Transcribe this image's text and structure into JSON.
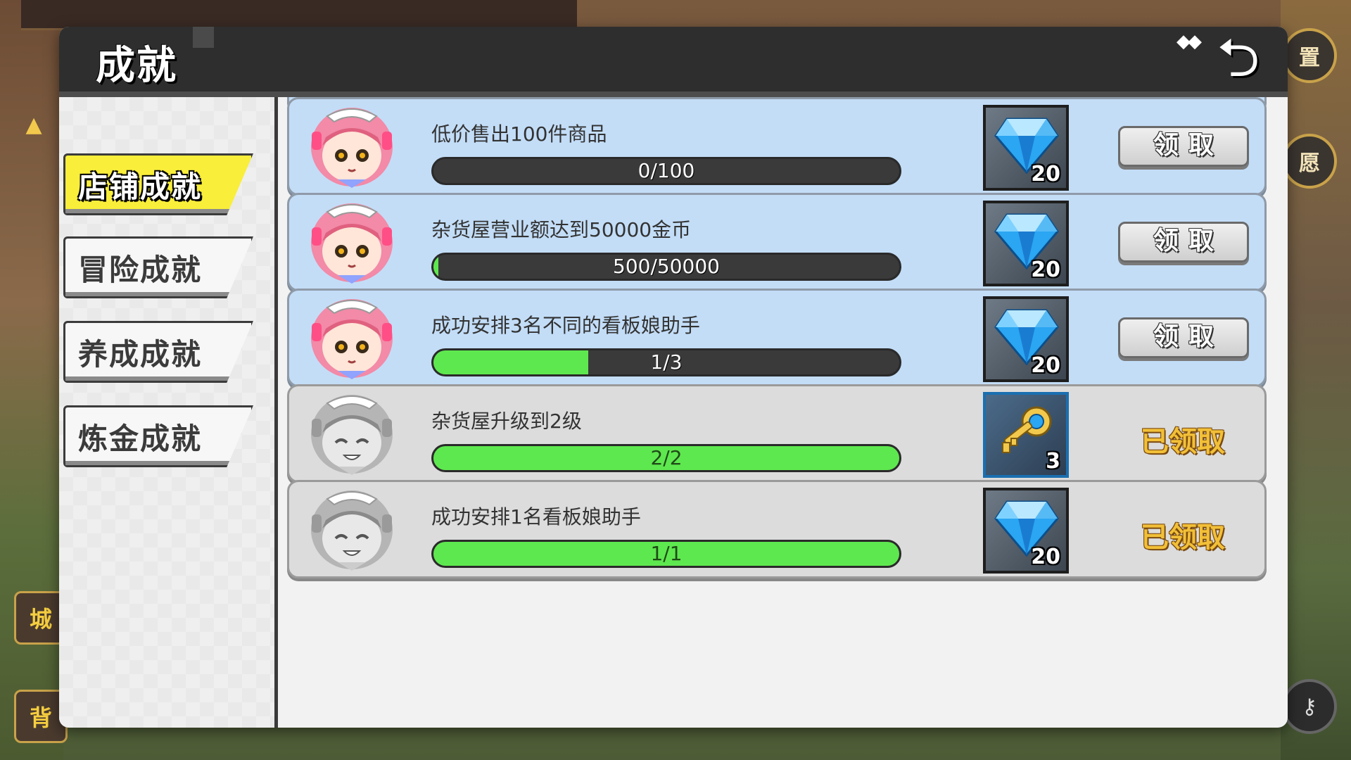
{
  "header": {
    "title": "成就"
  },
  "sidebar": {
    "tabs": [
      {
        "label": "店铺成就",
        "active": true
      },
      {
        "label": "冒险成就",
        "active": false
      },
      {
        "label": "养成成就",
        "active": false
      },
      {
        "label": "炼金成就",
        "active": false
      }
    ]
  },
  "background": {
    "settings_label": "置",
    "wish_label": "愿",
    "city_label": "城",
    "bag_label": "背"
  },
  "achievements": [
    {
      "task": "低价售出100件商品",
      "progress_text": "0/100",
      "progress_fraction": 0,
      "reward_icon": "diamond-icon",
      "reward_count": "20",
      "status": "claimable",
      "button_label": "领取"
    },
    {
      "task": "杂货屋营业额达到50000金币",
      "progress_text": "500/50000",
      "progress_fraction": 0.01,
      "reward_icon": "diamond-icon",
      "reward_count": "20",
      "status": "claimable",
      "button_label": "领取"
    },
    {
      "task": "成功安排3名不同的看板娘助手",
      "progress_text": "1/3",
      "progress_fraction": 0.333,
      "reward_icon": "diamond-icon",
      "reward_count": "20",
      "status": "claimable",
      "button_label": "领取"
    },
    {
      "task": "杂货屋升级到2级",
      "progress_text": "2/2",
      "progress_fraction": 1,
      "reward_icon": "key-icon",
      "reward_count": "3",
      "status": "claimed",
      "claimed_label": "已领取"
    },
    {
      "task": "成功安排1名看板娘助手",
      "progress_text": "1/1",
      "progress_fraction": 1,
      "reward_icon": "diamond-icon",
      "reward_count": "20",
      "status": "claimed",
      "claimed_label": "已领取"
    }
  ],
  "colors": {
    "active_tab": "#f9ee3a",
    "row_active": "#c3ddf7",
    "row_claimed": "#dcdcdc",
    "progress_fill": "#5ee84f",
    "claimed_text": "#f2c038"
  }
}
